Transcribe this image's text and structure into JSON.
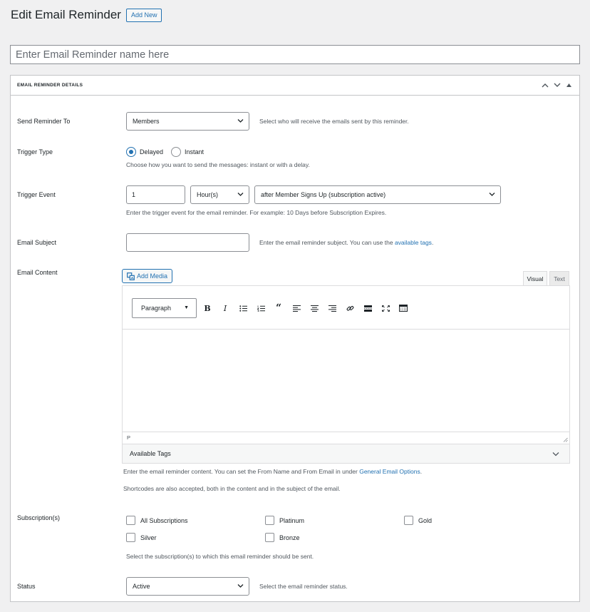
{
  "page": {
    "title": "Edit Email Reminder",
    "add_new_label": "Add New"
  },
  "title_field": {
    "placeholder": "Enter Email Reminder name here",
    "value": ""
  },
  "metabox": {
    "title": "EMAIL REMINDER DETAILS"
  },
  "send_to": {
    "label": "Send Reminder To",
    "value": "Members",
    "description": "Select who will receive the emails sent by this reminder."
  },
  "trigger_type": {
    "label": "Trigger Type",
    "options": [
      {
        "label": "Delayed",
        "checked": true
      },
      {
        "label": "Instant",
        "checked": false
      }
    ],
    "description": "Choose how you want to send the messages: instant or with a delay."
  },
  "trigger_event": {
    "label": "Trigger Event",
    "amount": "1",
    "unit": "Hour(s)",
    "event": "after Member Signs Up (subscription active)",
    "description": "Enter the trigger event for the email reminder. For example: 10 Days before Subscription Expires."
  },
  "email_subject": {
    "label": "Email Subject",
    "value": "",
    "description_prefix": "Enter the email reminder subject. You can use the ",
    "description_link": "available tags",
    "description_suffix": "."
  },
  "email_content": {
    "label": "Email Content",
    "add_media_label": "Add Media",
    "tabs": {
      "visual": "Visual",
      "text": "Text"
    },
    "format": "Paragraph",
    "status_path": "P",
    "available_tags_label": "Available Tags",
    "description_prefix": "Enter the email reminder content. You can set the From Name and From Email in under ",
    "description_link": "General Email Options",
    "description_suffix": ".",
    "shortcodes_note": "Shortcodes are also accepted, both in the content and in the subject of the email."
  },
  "subscriptions": {
    "label": "Subscription(s)",
    "options": [
      {
        "label": "All Subscriptions",
        "checked": false
      },
      {
        "label": "Platinum",
        "checked": false
      },
      {
        "label": "Gold",
        "checked": false
      },
      {
        "label": "Silver",
        "checked": false
      },
      {
        "label": "Bronze",
        "checked": false
      }
    ],
    "description": "Select the subscription(s) to which this email reminder should be sent."
  },
  "status": {
    "label": "Status",
    "value": "Active",
    "description": "Select the email reminder status."
  },
  "icons": {
    "collapse_up": "chevron-up-icon",
    "collapse_down": "chevron-down-icon",
    "toggle": "triangle-up-icon",
    "dropdown": "chevron-down-icon",
    "media": "media-icon"
  }
}
